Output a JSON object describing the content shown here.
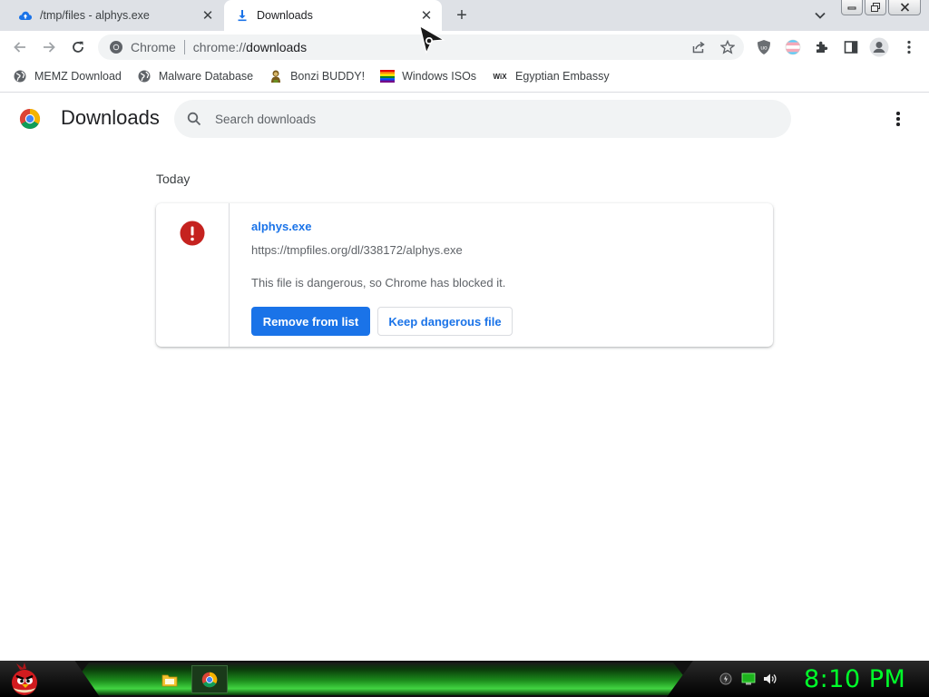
{
  "tabs": [
    {
      "title": "/tmp/files - alphys.exe",
      "icon": "cloud-upload-icon",
      "close": "✕"
    },
    {
      "title": "Downloads",
      "icon": "download-icon",
      "close": "✕",
      "active": true
    }
  ],
  "new_tab_label": "+",
  "omnibox": {
    "site_label": "Chrome",
    "url_scheme": "chrome://",
    "url_path": "downloads"
  },
  "bookmarks": [
    {
      "label": "MEMZ Download",
      "icon": "globe-icon"
    },
    {
      "label": "Malware Database",
      "icon": "globe-icon"
    },
    {
      "label": "Bonzi BUDDY!",
      "icon": "bonzi-icon"
    },
    {
      "label": "Windows ISOs",
      "icon": "rainbow-flag-icon"
    },
    {
      "label": "Egyptian Embassy",
      "icon": "wix-icon",
      "icon_text": "WiX"
    }
  ],
  "downloads_page": {
    "title": "Downloads",
    "search_placeholder": "Search downloads"
  },
  "section_label": "Today",
  "download_item": {
    "file_name": "alphys.exe",
    "url": "https://tmpfiles.org/dl/338172/alphys.exe",
    "description": "This file is dangerous, so Chrome has blocked it.",
    "primary_action": "Remove from list",
    "secondary_action": "Keep dangerous file",
    "status_icon": "warning-icon"
  },
  "taskbar": {
    "clock": "8:10 PM"
  },
  "colors": {
    "accent": "#1a73e8",
    "danger": "#c5221f",
    "clock": "#00ff2a",
    "tabstrip": "#dee1e6"
  }
}
